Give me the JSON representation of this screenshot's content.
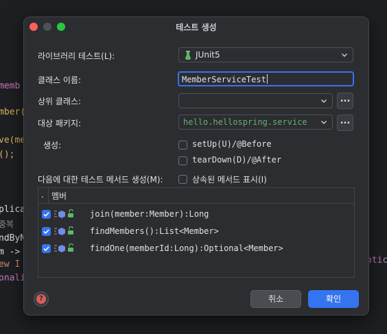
{
  "background": {
    "lines": [
      {
        "text": "memb",
        "color": "#c77dbb"
      },
      {
        "text": "mber(",
        "color": "#dbb35c"
      },
      {
        "text": "ve(mem",
        "color": "#dbb35c"
      },
      {
        "text": "();",
        "color": "#dbb35c"
      },
      {
        "text": "plica",
        "color": "#dfe1e5"
      },
      {
        "text": "중복",
        "color": "#8c8f94"
      },
      {
        "text": "ndByN",
        "color": "#dfe1e5"
      },
      {
        "text": "m ->",
        "color": "#dfe1e5"
      },
      {
        "text": "ew I",
        "color": "#cf8e6d"
      },
      {
        "text": "onali",
        "color": "#c77dbb"
      }
    ],
    "right_fragment": "otic"
  },
  "dialog": {
    "title": "테스트 생성",
    "testing_library": {
      "label": "라이브러리 테스트(L):",
      "value": "JUnit5"
    },
    "class_name": {
      "label": "클래스 이름:",
      "value": "MemberServiceTest"
    },
    "superclass": {
      "label": "상위 클래스:",
      "value": "",
      "browse": "..."
    },
    "destination_package": {
      "label": "대상 패키지:",
      "value": "hello.hellospring.service",
      "browse": "..."
    },
    "generate": {
      "label": "생성:",
      "setup": "setUp(U)/@Before",
      "teardown": "tearDown(D)/@After"
    },
    "methods_label": "다음에 대한 테스트 메서드 생성(M):",
    "show_inherited": "상속된 메서드 표시(I)",
    "members_table": {
      "col_check": ".",
      "col_member": "멤버",
      "rows": [
        {
          "signature": "join(member:Member):Long",
          "checked": true
        },
        {
          "signature": "findMembers():List<Member>",
          "checked": true
        },
        {
          "signature": "findOne(memberId:Long):Optional<Member>",
          "checked": true
        }
      ]
    },
    "help_glyph": "?",
    "cancel": "취소",
    "ok": "확인"
  },
  "colors": {
    "accent": "#3574f0",
    "package_green": "#6aab73",
    "dialog_bg": "#2b2d30"
  }
}
